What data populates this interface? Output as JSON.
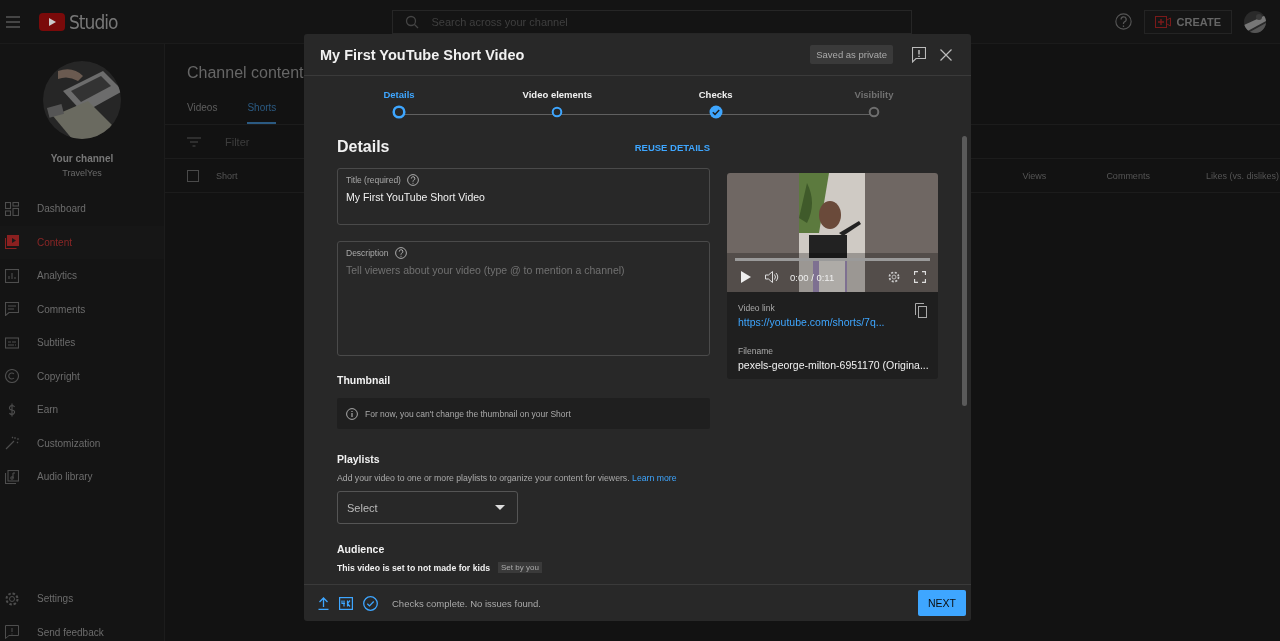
{
  "app_bar": {
    "logo_text": "Studio",
    "search": {
      "placeholder": "Search across your channel"
    },
    "create_button": "CREATE"
  },
  "sidebar": {
    "channel_label": "Your channel",
    "channel_name": "TravelYes",
    "items": [
      {
        "label": "Dashboard",
        "selected": false
      },
      {
        "label": "Content",
        "selected": true
      },
      {
        "label": "Analytics",
        "selected": false
      },
      {
        "label": "Comments",
        "selected": false
      },
      {
        "label": "Subtitles",
        "selected": false
      },
      {
        "label": "Copyright",
        "selected": false
      },
      {
        "label": "Earn",
        "selected": false
      },
      {
        "label": "Customization",
        "selected": false
      },
      {
        "label": "Audio library",
        "selected": false
      }
    ],
    "footer_items": [
      {
        "label": "Settings"
      },
      {
        "label": "Send feedback"
      }
    ]
  },
  "page": {
    "title": "Channel content",
    "tabs": [
      {
        "label": "Videos",
        "selected": false
      },
      {
        "label": "Shorts",
        "selected": true
      }
    ],
    "filter": {
      "placeholder": "Filter"
    },
    "table": {
      "columns": [
        "Short",
        "Views",
        "Comments",
        "Likes (vs. dislikes)"
      ],
      "select_all_checked": false
    }
  },
  "dialog": {
    "title": "My First YouTube Short Video",
    "save_status": "Saved as private",
    "steps": [
      {
        "label": "Details",
        "selected": true,
        "visited": true,
        "checked": false
      },
      {
        "label": "Video elements",
        "selected": false,
        "visited": true,
        "checked": false
      },
      {
        "label": "Checks",
        "selected": false,
        "visited": true,
        "checked": true
      },
      {
        "label": "Visibility",
        "selected": false,
        "visited": false,
        "checked": false
      }
    ],
    "heading": "Details",
    "reuse_button": "REUSE DETAILS",
    "title_field": {
      "label": "Title (required)",
      "value": "My First YouTube Short Video"
    },
    "description_field": {
      "label": "Description",
      "placeholder": "Tell viewers about your video (type @ to mention a channel)"
    },
    "thumbnail": {
      "heading": "Thumbnail",
      "notice": "For now, you can't change the thumbnail on your Short"
    },
    "playlists": {
      "heading": "Playlists",
      "text": "Add your video to one or more playlists to organize your content for viewers.",
      "link": "Learn more",
      "select": "Select"
    },
    "audience": {
      "heading": "Audience",
      "text": "This video is set to not made for kids",
      "badge": "Set by you"
    },
    "preview": {
      "time": "0:00 / 0:11",
      "video_link_label": "Video link",
      "video_link": "https://youtube.com/shorts/7q...",
      "filename_label": "Filename",
      "filename": "pexels-george-milton-6951170 (Origina..."
    },
    "footer": {
      "status": "Checks complete. No issues found.",
      "next_button": "NEXT"
    }
  }
}
